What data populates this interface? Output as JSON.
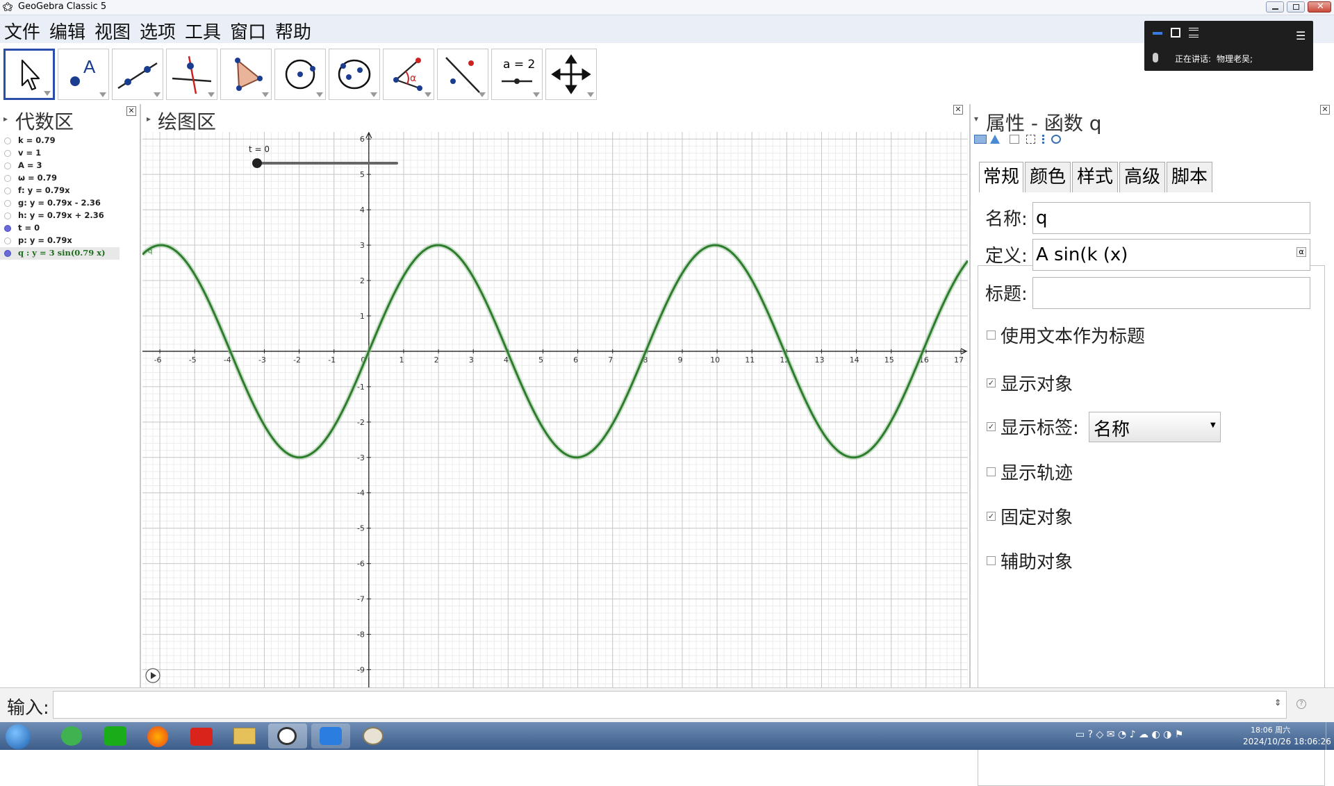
{
  "window": {
    "title": "GeoGebra Classic 5"
  },
  "menu": [
    "文件",
    "编辑",
    "视图",
    "选项",
    "工具",
    "窗口",
    "帮助"
  ],
  "toolbar": {
    "tools": [
      {
        "name": "move-tool",
        "icon": "arrow-cursor-icon"
      },
      {
        "name": "point-tool",
        "icon": "point-a-icon"
      },
      {
        "name": "line-tool",
        "icon": "line-through-points-icon"
      },
      {
        "name": "perpendicular-tool",
        "icon": "perpendicular-line-icon"
      },
      {
        "name": "polygon-tool",
        "icon": "polygon-icon"
      },
      {
        "name": "circle-tool",
        "icon": "circle-center-icon"
      },
      {
        "name": "conic-tool",
        "icon": "ellipse-icon"
      },
      {
        "name": "angle-tool",
        "icon": "angle-alpha-icon"
      },
      {
        "name": "reflect-tool",
        "icon": "reflect-line-icon"
      },
      {
        "name": "slider-tool",
        "icon": "slider-icon",
        "label": "a = 2"
      },
      {
        "name": "move-view-tool",
        "icon": "move-arrows-icon"
      }
    ]
  },
  "algebra": {
    "title": "代数区",
    "items": [
      {
        "text": "k = 0.79",
        "shown": false
      },
      {
        "text": "v = 1",
        "shown": false
      },
      {
        "text": "A = 3",
        "shown": false
      },
      {
        "text": "ω = 0.79",
        "shown": false
      },
      {
        "text": "f: y = 0.79x",
        "shown": false
      },
      {
        "text": "g: y = 0.79x - 2.36",
        "shown": false
      },
      {
        "text": "h: y = 0.79x + 2.36",
        "shown": false
      },
      {
        "text": "t = 0",
        "shown": true
      },
      {
        "text": "p: y = 0.79x",
        "shown": false
      },
      {
        "text": "q : y = 3 sin(0.79 x)",
        "shown": true,
        "selected": true
      }
    ]
  },
  "graphics": {
    "title": "绘图区",
    "slider": {
      "label": "t = 0",
      "value": 0
    },
    "curve_label": "q",
    "curve_color": "#2d7d2d",
    "function": {
      "A": 3,
      "k": 0.79
    }
  },
  "chart_data": {
    "type": "line",
    "x_range": [
      -6.5,
      17.2
    ],
    "y_range": [
      -9.5,
      6.2
    ],
    "x_ticks": [
      -6,
      -5,
      -4,
      -3,
      -2,
      -1,
      0,
      1,
      2,
      3,
      4,
      5,
      6,
      7,
      8,
      9,
      10,
      11,
      12,
      13,
      14,
      15,
      16,
      17
    ],
    "y_ticks": [
      -9,
      -8,
      -7,
      -6,
      -5,
      -4,
      -3,
      -2,
      -1,
      1,
      2,
      3,
      4,
      5,
      6
    ],
    "grid": true,
    "series": [
      {
        "name": "q",
        "formula": "3 sin(0.79 x)"
      }
    ]
  },
  "properties": {
    "title": "属性 - 函数 q",
    "tabs": [
      "常规",
      "颜色",
      "样式",
      "高级",
      "脚本"
    ],
    "active_tab": "常规",
    "name_label": "名称:",
    "name_value": "q",
    "definition_label": "定义:",
    "definition_value": "A sin(k (x)",
    "caption_label": "标题:",
    "caption_value": "",
    "alpha_button": "α",
    "checkboxes": [
      {
        "label": "使用文本作为标题",
        "checked": false
      },
      {
        "label": "显示对象",
        "checked": true
      },
      {
        "label": "显示标签:",
        "checked": true
      },
      {
        "label": "显示轨迹",
        "checked": false
      },
      {
        "label": "固定对象",
        "checked": true
      },
      {
        "label": "辅助对象",
        "checked": false
      }
    ],
    "label_mode": "名称"
  },
  "inputbar": {
    "label": "输入:",
    "value": ""
  },
  "meeting": {
    "speaking_label": "正在讲话:",
    "speaker": "物理老吴;"
  },
  "taskbar": {
    "time": "18:06 周六",
    "date": "2024/10/26 18:06:26"
  }
}
